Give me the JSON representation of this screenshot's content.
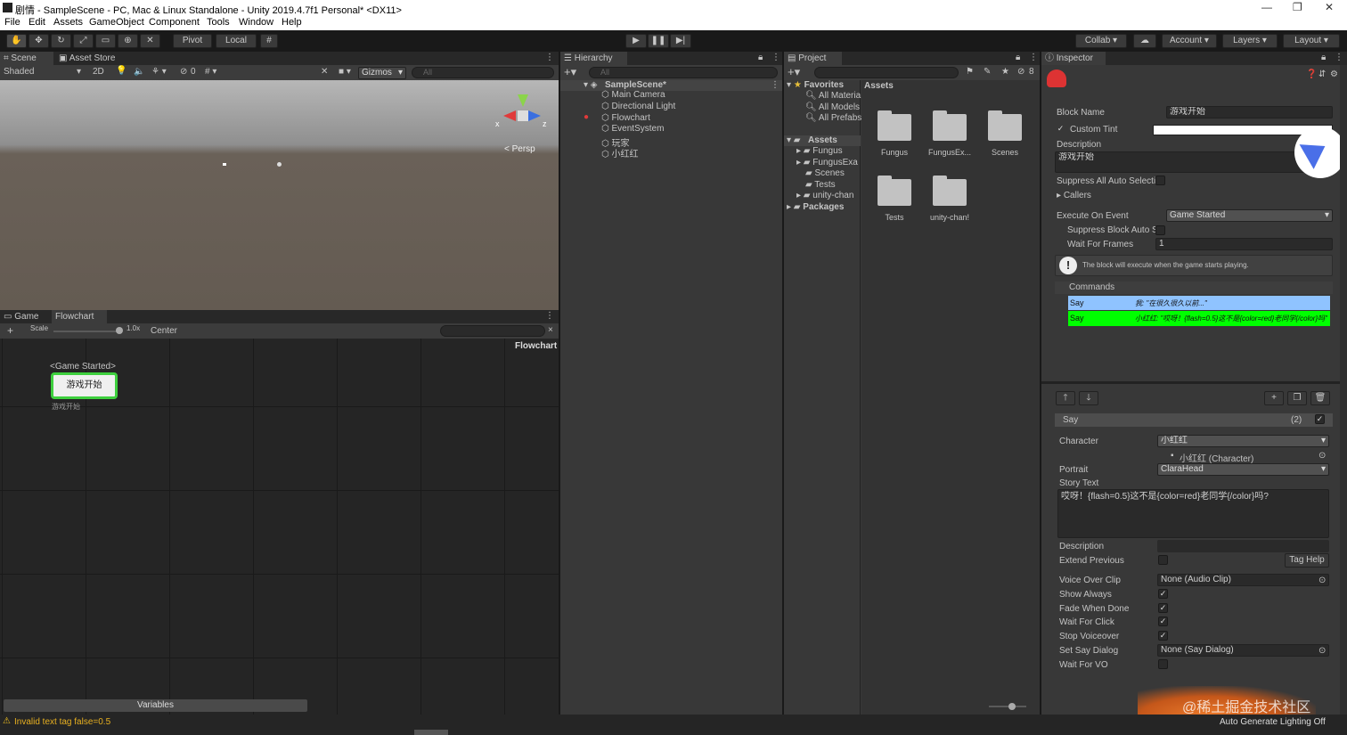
{
  "window": {
    "title": "剧情 - SampleScene - PC, Mac & Linux Standalone - Unity 2019.4.7f1 Personal* <DX11>"
  },
  "menu": [
    "File",
    "Edit",
    "Assets",
    "GameObject",
    "Component",
    "Tools",
    "Window",
    "Help"
  ],
  "toolbar": {
    "pivot": "Pivot",
    "local": "Local",
    "collab": "Collab",
    "account": "Account",
    "layers": "Layers",
    "layout": "Layout"
  },
  "scene": {
    "tab": "Scene",
    "tab2": "Asset Store",
    "shading": "Shaded",
    "mode2d": "2D",
    "hidden_count": "0",
    "gizmos": "Gizmos",
    "search_placeholder": "All",
    "persp": "Persp",
    "axis_x": "x",
    "axis_z": "z"
  },
  "flowchart": {
    "tab_game": "Game",
    "tab_flowchart": "Flowchart",
    "scale_label": "Scale",
    "scale_value": "1.0x",
    "center": "Center",
    "title": "Flowchart",
    "event_label": "<Game Started>",
    "block_name": "游戏开始",
    "block_desc": "游戏开始",
    "variables": "Variables"
  },
  "hierarchy": {
    "tab": "Hierarchy",
    "search_placeholder": "All",
    "scene": "SampleScene*",
    "items": [
      "Main Camera",
      "Directional Light",
      "Flowchart",
      "EventSystem",
      "玩家",
      "小红红"
    ]
  },
  "project": {
    "tab": "Project",
    "favorites": "Favorites",
    "fav_items": [
      "All Materia",
      "All Models",
      "All Prefabs"
    ],
    "assets": "Assets",
    "asset_folders": [
      "Fungus",
      "FungusExa",
      "Scenes",
      "Tests",
      "unity-chan"
    ],
    "packages": "Packages",
    "breadcrumb": "Assets",
    "hidden_count": "8",
    "grid": [
      "Fungus",
      "FungusEx...",
      "Scenes",
      "Tests",
      "unity-chan!"
    ]
  },
  "inspector": {
    "tab": "Inspector",
    "block_name_label": "Block Name",
    "block_name": "游戏开始",
    "custom_tint": "Custom Tint",
    "description_label": "Description",
    "description": "游戏开始",
    "suppress_label": "Suppress All Auto Selecti",
    "callers": "Callers",
    "execute_label": "Execute On Event",
    "execute_value": "Game Started",
    "suppress_block": "Suppress Block Auto S",
    "wait_frames_label": "Wait For Frames",
    "wait_frames": "1",
    "help_text": "The block will execute when the game starts playing.",
    "commands_label": "Commands",
    "commands": [
      {
        "name": "Say",
        "text": "我: \"在很久很久以前...\""
      },
      {
        "name": "Say",
        "text": "小红红: \"哎呀！{flash=0.5}这不是{color=red}老同学{/color}吗\""
      }
    ],
    "say_header": "Say",
    "say_index": "(2)",
    "character_label": "Character",
    "character_value": "小红红",
    "character_obj": "小红红 (Character)",
    "portrait_label": "Portrait",
    "portrait_value": "ClaraHead",
    "story_label": "Story Text",
    "story_text": "哎呀！{flash=0.5}这不是{color=red}老同学{/color}吗?",
    "desc2_label": "Description",
    "extend_label": "Extend Previous",
    "tag_help": "Tag Help",
    "voice_label": "Voice Over Clip",
    "voice_value": "None (Audio Clip)",
    "show_always": "Show Always",
    "fade_done": "Fade When Done",
    "wait_click": "Wait For Click",
    "stop_voice": "Stop Voiceover",
    "say_dialog_label": "Set Say Dialog",
    "say_dialog_value": "None (Say Dialog)",
    "wait_vo": "Wait For VO"
  },
  "status": {
    "warning": "Invalid text tag false=0.5",
    "right": "Auto Generate Lighting Off",
    "watermark": "@稀土掘金技术社区"
  },
  "colors": {
    "selected_command": "#8fc3ff",
    "active_command": "#00ff00",
    "block_border": "#3ecf3e"
  }
}
